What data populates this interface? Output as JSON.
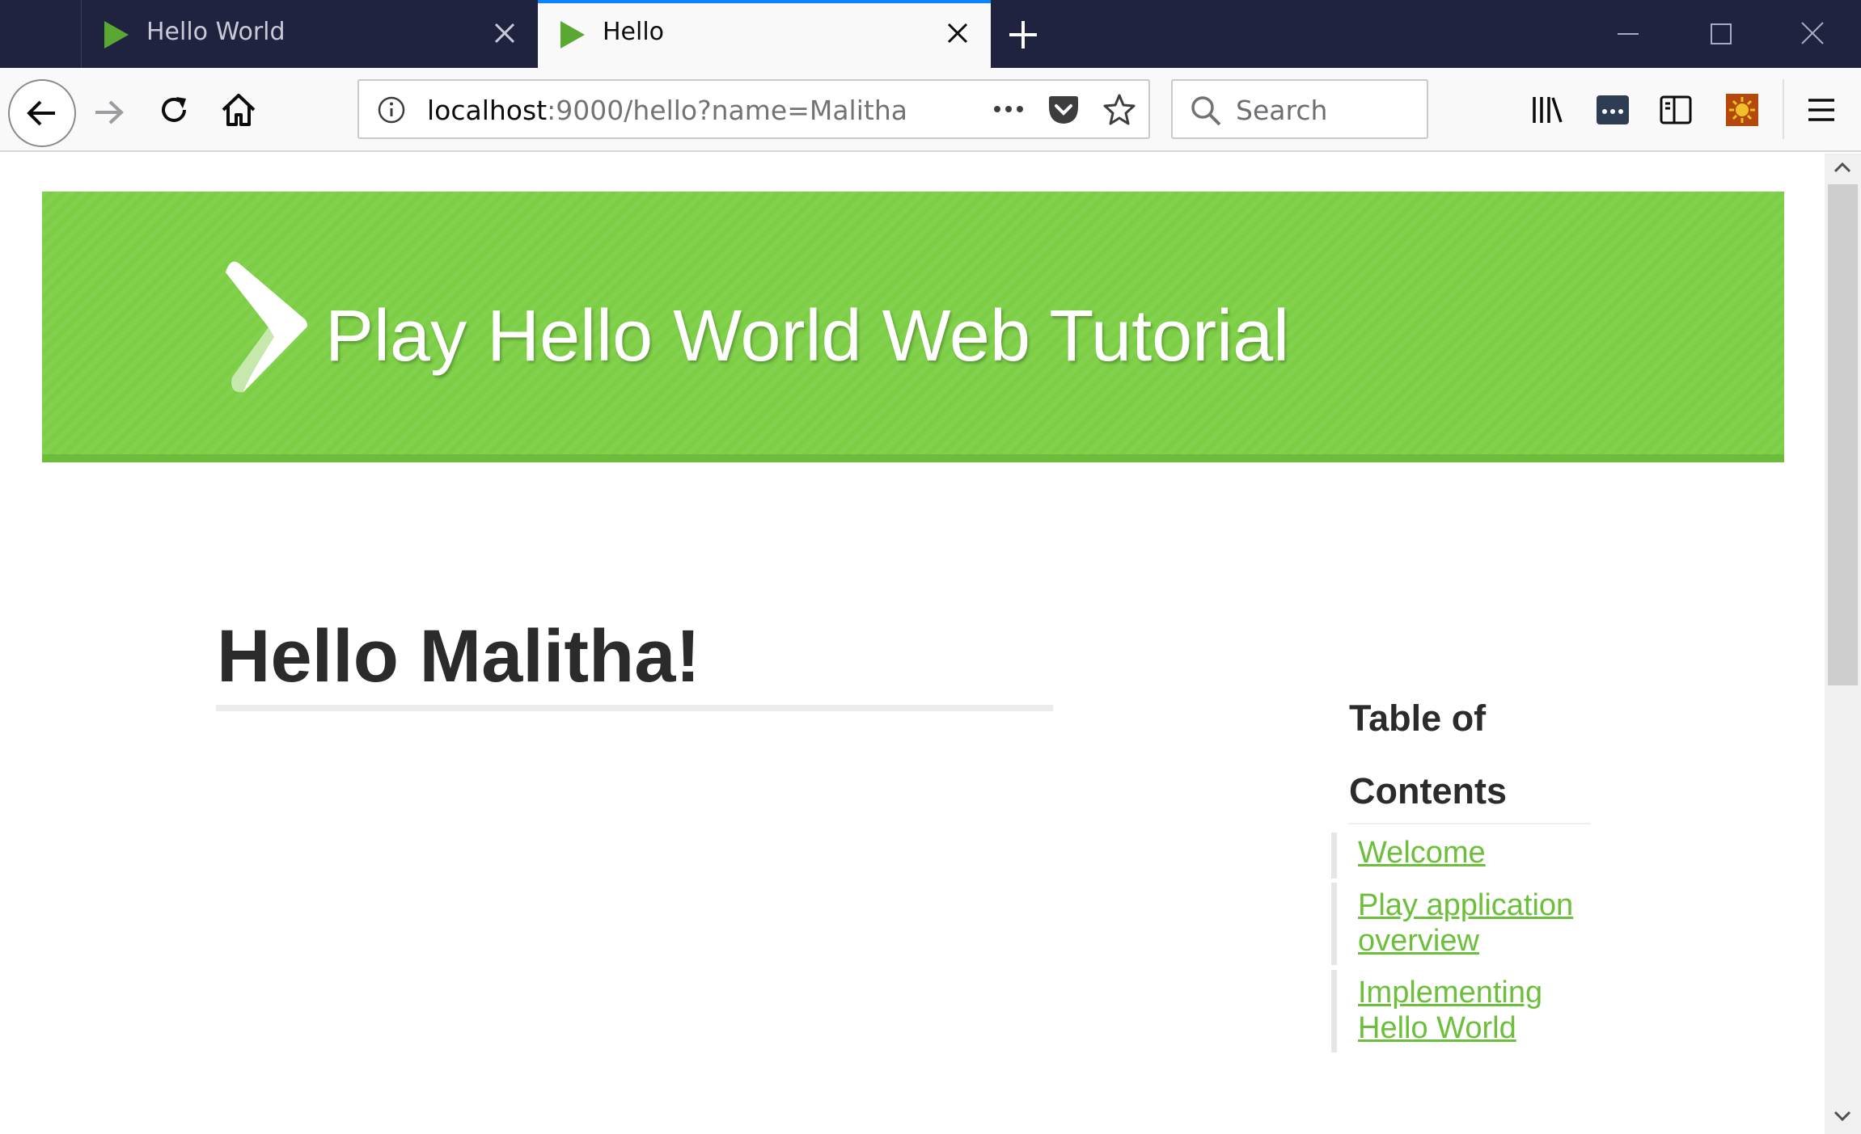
{
  "browser": {
    "tabs": [
      {
        "title": "Hello World",
        "active": false
      },
      {
        "title": "Hello",
        "active": true
      }
    ],
    "url": {
      "host": "localhost",
      "rest": ":9000/hello?name=Malitha"
    },
    "search_placeholder": "Search",
    "colors": {
      "tabbar": "#202340",
      "active_tab_accent": "#0a84ff",
      "toolbar": "#f9f9fa"
    }
  },
  "page": {
    "banner_title": "Play Hello World Web Tutorial",
    "heading": "Hello Malitha!",
    "toc": {
      "title": "Table of Contents",
      "items": [
        {
          "label": "Welcome"
        },
        {
          "label": "Play application overview"
        },
        {
          "label": "Implementing Hello World"
        }
      ]
    },
    "colors": {
      "banner": "#7ccf45",
      "link": "#6cbf3a",
      "text": "#2b2b2b"
    }
  }
}
